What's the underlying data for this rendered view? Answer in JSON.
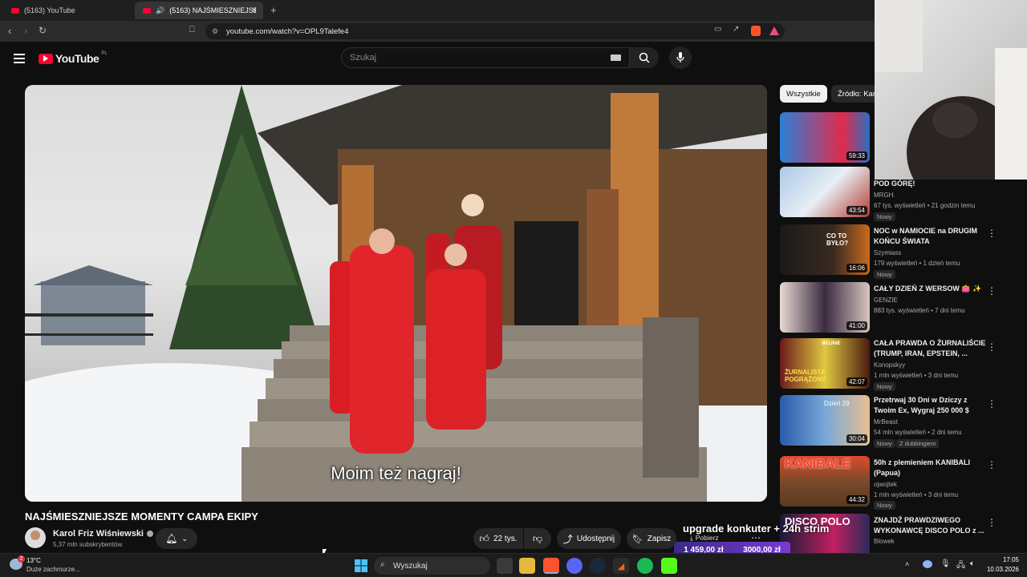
{
  "browser": {
    "tabs": [
      {
        "label": "(5163) YouTube"
      },
      {
        "label": "(5163) NAJŚMIESZNIEJSZE M"
      }
    ],
    "url": "youtube.com/watch?v=OPL9Talefe4"
  },
  "youtube": {
    "logo": "YouTube",
    "logo_region": "PL",
    "search_placeholder": "Szukaj"
  },
  "video": {
    "subtitle": "Moim też nagraj!",
    "title": "NAJŚMIESZNIEJSZE MOMENTY CAMPA EKIPY",
    "channel": "Karol Friz Wiśniewski",
    "subscribers": "5,37 mln subskrybentów",
    "likes": "22 tys.",
    "share_label": "Udostępnij",
    "save_label": "Zapisz",
    "download_label": "Pobierz"
  },
  "sidebar": {
    "chips": [
      "Wszystkie",
      "Źródło: Kar"
    ],
    "recommendations": [
      {
        "title": "",
        "channel": "",
        "views": "",
        "duration": "59:33",
        "badge": ""
      },
      {
        "title": "POD GÓRĘ!",
        "channel": "MRGH.",
        "views": "67 tys. wyświetleń • 21 godzin temu",
        "duration": "43:54",
        "badge": "Nowy"
      },
      {
        "title": "NOC w NAMIOCIE na DRUGIM KOŃCU ŚWIATA",
        "channel": "Szymiass",
        "views": "179 wyświetleń • 1 dzień temu",
        "duration": "16:06",
        "badge": "Nowy"
      },
      {
        "title": "CAŁY DZIEŃ Z WERSOW 👛 ✨",
        "channel": "GENZIE",
        "views": "883 tys. wyświetleń • 7 dni temu",
        "duration": "41:00",
        "badge": ""
      },
      {
        "title": "CAŁA PRAWDA O ŻURNALIŚCIE (TRUMP, IRAN, EPSTEIN, ...",
        "channel": "Konopskyy",
        "views": "1 mln wyświetleń • 3 dni temu",
        "duration": "42:07",
        "badge": "Nowy"
      },
      {
        "title": "Przetrwaj 30 Dni w Dziczy z Twoim Ex, Wygraj 250 000 $",
        "channel": "MrBeast",
        "views": "54 mln wyświetleń • 2 dni temu",
        "duration": "30:04",
        "badge": "Nowy",
        "badge2": "Z dubbingiem"
      },
      {
        "title": "50h z plemieniem KANIBALI (Papua)",
        "channel": "ojwojtek",
        "views": "1 mln wyświetleń • 3 dni temu",
        "duration": "44:32",
        "badge": "Nowy"
      },
      {
        "title": "ZNAJDŹ PRAWDZIWEGO WYKONAWCĘ DISCO POLO z ...",
        "channel": "Blowek",
        "views": "",
        "duration": "",
        "badge": ""
      }
    ],
    "thumb_texts": [
      "CO TO BYŁO?",
      "WOJNIE",
      "ŻURNALISTA POGRĄŻONY",
      "Dzień 29",
      "KANIBALE",
      "DISCO POLO"
    ]
  },
  "overlay": {
    "text": "upgrade konkuter + 24h strim",
    "amount1": "1 459,00 zł",
    "amount2": "3000,00 zł"
  },
  "taskbar": {
    "temp": "13°C",
    "weather": "Duże zachmurze...",
    "weather_badge": "2",
    "search": "Wyszukaj",
    "time": "17:05",
    "date": "10.03.2026"
  },
  "colors": {
    "yt_red": "#ff0033",
    "bg": "#0f0f0f",
    "chip_active_bg": "#f1f1f1"
  }
}
